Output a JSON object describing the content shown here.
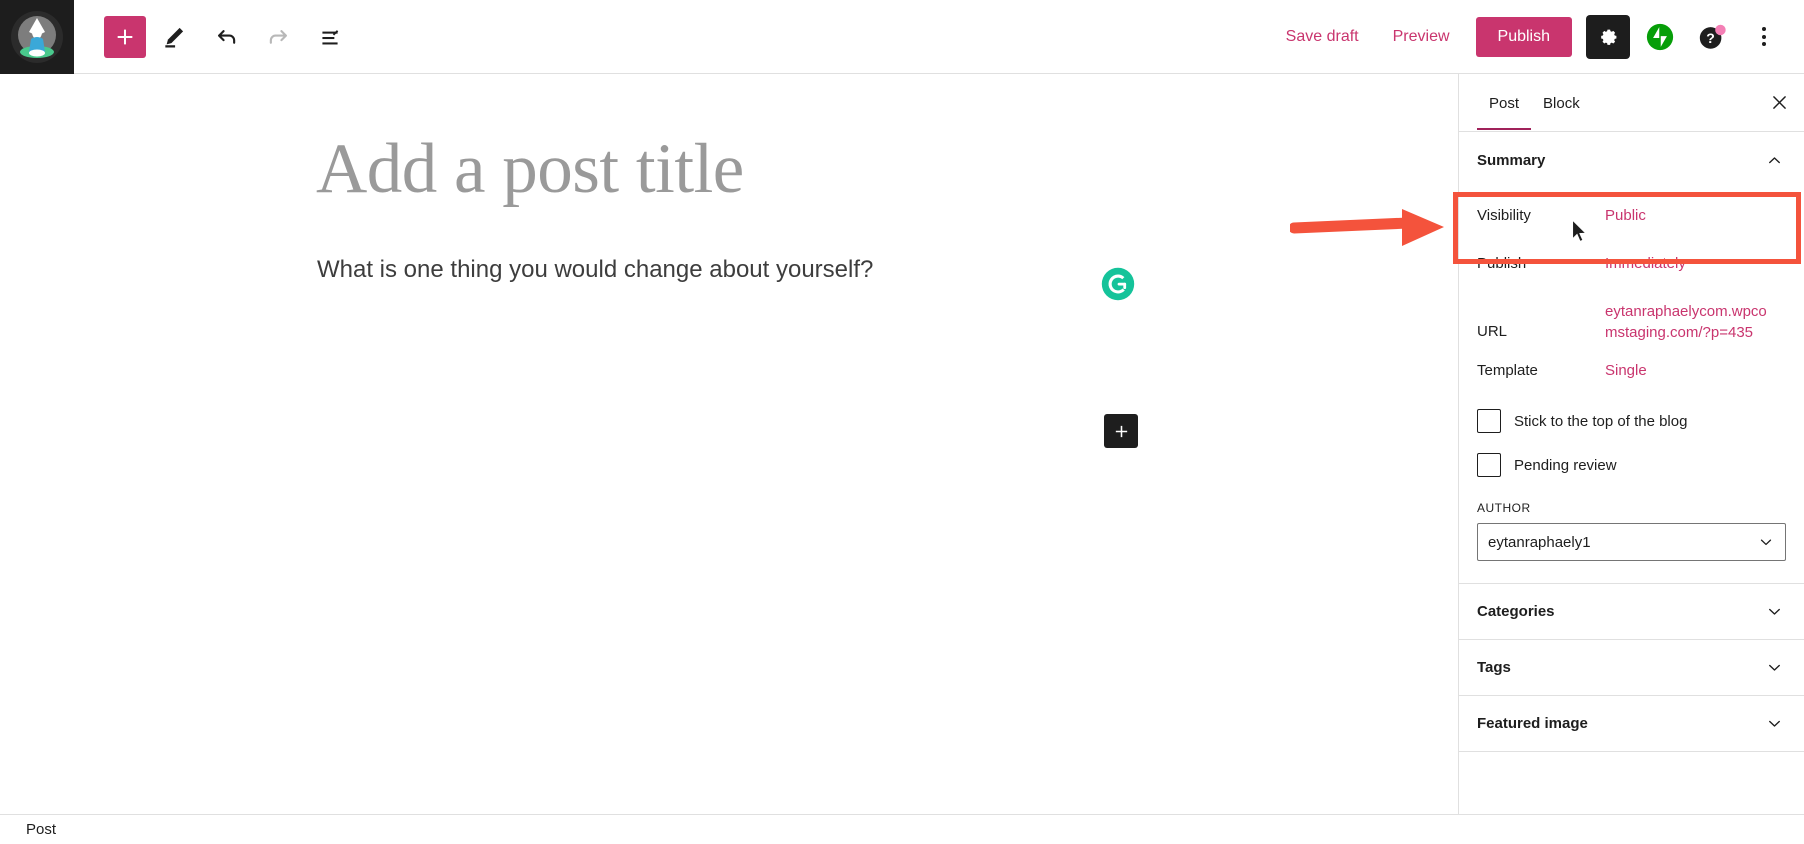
{
  "topbar": {
    "logo_icon": "yoga-meditation-logo",
    "add_block_icon": "plus-icon",
    "tools_icon": "pencil-icon",
    "undo_icon": "undo-arrow-icon",
    "redo_icon": "redo-arrow-icon",
    "details_icon": "document-outline-icon",
    "save_draft_label": "Save draft",
    "preview_label": "Preview",
    "publish_label": "Publish",
    "settings_icon": "gear-icon",
    "jetpack_icon": "jetpack-bolt-icon",
    "help_icon": "help-question-icon",
    "more_icon": "more-vertical-dots-icon"
  },
  "editor": {
    "title_placeholder": "Add a post title",
    "paragraph_text": "What is one thing you would change about yourself?",
    "grammarly_icon": "grammarly-g-icon",
    "inserter_icon": "plus-icon"
  },
  "sidebar": {
    "tabs": [
      {
        "label": "Post",
        "active": true
      },
      {
        "label": "Block",
        "active": false
      }
    ],
    "close_icon": "close-x-icon",
    "summary": {
      "title": "Summary",
      "chevron_icon": "chevron-up-icon",
      "rows": [
        {
          "label": "Visibility",
          "value": "Public"
        },
        {
          "label": "Publish",
          "value": "Immediately"
        },
        {
          "label": "URL",
          "value": "eytanraphaelycom.wpcomstaging.com/?p=435"
        },
        {
          "label": "Template",
          "value": "Single"
        }
      ],
      "checkboxes": [
        {
          "label": "Stick to the top of the blog",
          "checked": false
        },
        {
          "label": "Pending review",
          "checked": false
        }
      ],
      "author_label": "AUTHOR",
      "author_value": "eytanraphaely1",
      "author_chevron_icon": "chevron-down-icon"
    },
    "panels": [
      {
        "title": "Categories",
        "chevron_icon": "chevron-down-icon"
      },
      {
        "title": "Tags",
        "chevron_icon": "chevron-down-icon"
      },
      {
        "title": "Featured image",
        "chevron_icon": "chevron-down-icon"
      }
    ]
  },
  "statusbar": {
    "label": "Post"
  },
  "annotations": {
    "highlight_color": "#f4533c",
    "arrow_color": "#f4533c",
    "target": "Visibility"
  },
  "colors": {
    "accent_pink": "#c9356e",
    "dark": "#1d1d1d",
    "jetpack_green": "#069e08",
    "grammarly_green": "#15c39a",
    "border": "#e0e0e0"
  }
}
